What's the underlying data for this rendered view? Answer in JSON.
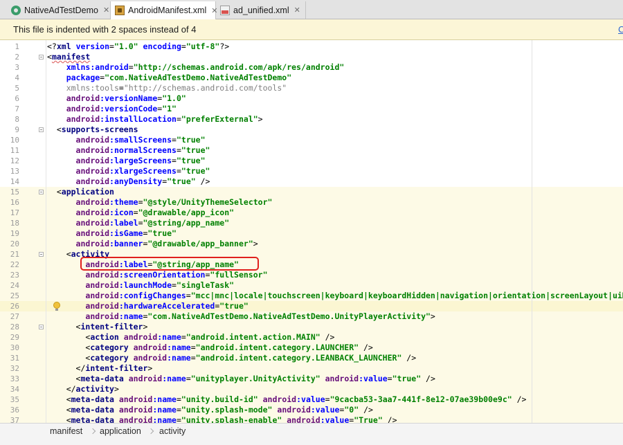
{
  "tabs": [
    {
      "label": "NativeAdTestDemo",
      "icon": "android-icon",
      "active": false
    },
    {
      "label": "AndroidManifest.xml",
      "icon": "manifest-icon",
      "active": true
    },
    {
      "label": "ad_unified.xml",
      "icon": "xml-file-icon",
      "active": false
    }
  ],
  "banner": {
    "message": "This file is indented with 2 spaces instead of 4",
    "link": "C"
  },
  "code_lines": [
    {
      "n": "1",
      "segs": [
        [
          "p",
          "<?"
        ],
        [
          "t",
          "xml "
        ],
        [
          "a",
          "version"
        ],
        [
          "p",
          "="
        ],
        [
          "v",
          "\"1.0\""
        ],
        [
          "p",
          " "
        ],
        [
          "a",
          "encoding"
        ],
        [
          "p",
          "="
        ],
        [
          "v",
          "\"utf-8\""
        ],
        [
          "p",
          "?>"
        ]
      ]
    },
    {
      "n": "2",
      "segs": [
        [
          "p",
          "<"
        ],
        [
          "ts",
          "manifest"
        ]
      ]
    },
    {
      "n": "3",
      "segs": [
        [
          "p",
          "    "
        ],
        [
          "a",
          "xmlns:android"
        ],
        [
          "p",
          "="
        ],
        [
          "v",
          "\"http://schemas.android.com/apk/res/android\""
        ]
      ]
    },
    {
      "n": "4",
      "segs": [
        [
          "p",
          "    "
        ],
        [
          "a",
          "package"
        ],
        [
          "p",
          "="
        ],
        [
          "v",
          "\"com.NativeAdTestDemo.NativeAdTestDemo\""
        ]
      ]
    },
    {
      "n": "5",
      "segs": [
        [
          "p",
          "    "
        ],
        [
          "g",
          "xmlns:tools"
        ],
        [
          "p",
          "="
        ],
        [
          "g",
          "\"http://schemas.android.com/tools\""
        ]
      ]
    },
    {
      "n": "6",
      "segs": [
        [
          "p",
          "    "
        ],
        [
          "n",
          "android"
        ],
        [
          "a",
          ":versionName"
        ],
        [
          "p",
          "="
        ],
        [
          "v",
          "\"1.0\""
        ]
      ]
    },
    {
      "n": "7",
      "segs": [
        [
          "p",
          "    "
        ],
        [
          "n",
          "android"
        ],
        [
          "a",
          ":versionCode"
        ],
        [
          "p",
          "="
        ],
        [
          "v",
          "\"1\""
        ]
      ]
    },
    {
      "n": "8",
      "segs": [
        [
          "p",
          "    "
        ],
        [
          "n",
          "android"
        ],
        [
          "a",
          ":installLocation"
        ],
        [
          "p",
          "="
        ],
        [
          "v",
          "\"preferExternal\""
        ],
        [
          "p",
          ">"
        ]
      ]
    },
    {
      "n": "9",
      "segs": [
        [
          "p",
          "  <"
        ],
        [
          "t",
          "supports-screens"
        ]
      ]
    },
    {
      "n": "10",
      "segs": [
        [
          "p",
          "      "
        ],
        [
          "n",
          "android"
        ],
        [
          "a",
          ":smallScreens"
        ],
        [
          "p",
          "="
        ],
        [
          "v",
          "\"true\""
        ]
      ]
    },
    {
      "n": "11",
      "segs": [
        [
          "p",
          "      "
        ],
        [
          "n",
          "android"
        ],
        [
          "a",
          ":normalScreens"
        ],
        [
          "p",
          "="
        ],
        [
          "v",
          "\"true\""
        ]
      ]
    },
    {
      "n": "12",
      "segs": [
        [
          "p",
          "      "
        ],
        [
          "n",
          "android"
        ],
        [
          "a",
          ":largeScreens"
        ],
        [
          "p",
          "="
        ],
        [
          "v",
          "\"true\""
        ]
      ]
    },
    {
      "n": "13",
      "segs": [
        [
          "p",
          "      "
        ],
        [
          "n",
          "android"
        ],
        [
          "a",
          ":xlargeScreens"
        ],
        [
          "p",
          "="
        ],
        [
          "v",
          "\"true\""
        ]
      ]
    },
    {
      "n": "14",
      "segs": [
        [
          "p",
          "      "
        ],
        [
          "n",
          "android"
        ],
        [
          "a",
          ":anyDensity"
        ],
        [
          "p",
          "="
        ],
        [
          "v",
          "\"true\""
        ],
        [
          "p",
          " />"
        ]
      ]
    },
    {
      "n": "15",
      "segs": [
        [
          "p",
          "  <"
        ],
        [
          "t",
          "application"
        ]
      ]
    },
    {
      "n": "16",
      "segs": [
        [
          "p",
          "      "
        ],
        [
          "n",
          "android"
        ],
        [
          "a",
          ":theme"
        ],
        [
          "p",
          "="
        ],
        [
          "v",
          "\"@style/UnityThemeSelector\""
        ]
      ]
    },
    {
      "n": "17",
      "segs": [
        [
          "p",
          "      "
        ],
        [
          "n",
          "android"
        ],
        [
          "a",
          ":icon"
        ],
        [
          "p",
          "="
        ],
        [
          "v",
          "\"@drawable/app_icon\""
        ]
      ]
    },
    {
      "n": "18",
      "segs": [
        [
          "p",
          "      "
        ],
        [
          "n",
          "android"
        ],
        [
          "a",
          ":label"
        ],
        [
          "p",
          "="
        ],
        [
          "v",
          "\"@string/app_name\""
        ]
      ]
    },
    {
      "n": "19",
      "segs": [
        [
          "p",
          "      "
        ],
        [
          "n",
          "android"
        ],
        [
          "a",
          ":isGame"
        ],
        [
          "p",
          "="
        ],
        [
          "v",
          "\"true\""
        ]
      ]
    },
    {
      "n": "20",
      "segs": [
        [
          "p",
          "      "
        ],
        [
          "n",
          "android"
        ],
        [
          "a",
          ":banner"
        ],
        [
          "p",
          "="
        ],
        [
          "v",
          "\"@drawable/app_banner\""
        ],
        [
          "p",
          ">"
        ]
      ]
    },
    {
      "n": "21",
      "segs": [
        [
          "p",
          "    <"
        ],
        [
          "t",
          "activity"
        ]
      ]
    },
    {
      "n": "22",
      "segs": [
        [
          "p",
          "        "
        ],
        [
          "n",
          "android"
        ],
        [
          "a",
          ":label"
        ],
        [
          "p",
          "="
        ],
        [
          "v",
          "\"@string/app_name\""
        ]
      ]
    },
    {
      "n": "23",
      "segs": [
        [
          "p",
          "        "
        ],
        [
          "n",
          "android"
        ],
        [
          "a",
          ":screenOrientation"
        ],
        [
          "p",
          "="
        ],
        [
          "v",
          "\"fullSensor\""
        ]
      ]
    },
    {
      "n": "24",
      "segs": [
        [
          "p",
          "        "
        ],
        [
          "n",
          "android"
        ],
        [
          "a",
          ":launchMode"
        ],
        [
          "p",
          "="
        ],
        [
          "v",
          "\"singleTask\""
        ]
      ]
    },
    {
      "n": "25",
      "segs": [
        [
          "p",
          "        "
        ],
        [
          "n",
          "android"
        ],
        [
          "a",
          ":configChanges"
        ],
        [
          "p",
          "="
        ],
        [
          "v",
          "\"mcc|mnc|locale|touchscreen|keyboard|keyboardHidden|navigation|orientation|screenLayout|uiMode\""
        ]
      ]
    },
    {
      "n": "26",
      "segs": [
        [
          "p",
          "        "
        ],
        [
          "n",
          "android"
        ],
        [
          "a",
          ":hardwareAccelerated"
        ],
        [
          "p",
          "="
        ],
        [
          "v",
          "\"true\""
        ]
      ]
    },
    {
      "n": "27",
      "segs": [
        [
          "p",
          "        "
        ],
        [
          "n",
          "android"
        ],
        [
          "a",
          ":name"
        ],
        [
          "p",
          "="
        ],
        [
          "v",
          "\"com.NativeAdTestDemo.NativeAdTestDemo.UnityPlayerActivity\""
        ],
        [
          "p",
          ">"
        ]
      ]
    },
    {
      "n": "28",
      "segs": [
        [
          "p",
          "      <"
        ],
        [
          "t",
          "intent-filter"
        ],
        [
          "p",
          ">"
        ]
      ]
    },
    {
      "n": "29",
      "segs": [
        [
          "p",
          "        <"
        ],
        [
          "t",
          "action "
        ],
        [
          "n",
          "android"
        ],
        [
          "a",
          ":name"
        ],
        [
          "p",
          "="
        ],
        [
          "v",
          "\"android.intent.action.MAIN\""
        ],
        [
          "p",
          " />"
        ]
      ]
    },
    {
      "n": "30",
      "segs": [
        [
          "p",
          "        <"
        ],
        [
          "t",
          "category "
        ],
        [
          "n",
          "android"
        ],
        [
          "a",
          ":name"
        ],
        [
          "p",
          "="
        ],
        [
          "v",
          "\"android.intent.category.LAUNCHER\""
        ],
        [
          "p",
          " />"
        ]
      ]
    },
    {
      "n": "31",
      "segs": [
        [
          "p",
          "        <"
        ],
        [
          "t",
          "category "
        ],
        [
          "n",
          "android"
        ],
        [
          "a",
          ":name"
        ],
        [
          "p",
          "="
        ],
        [
          "v",
          "\"android.intent.category.LEANBACK_LAUNCHER\""
        ],
        [
          "p",
          " />"
        ]
      ]
    },
    {
      "n": "32",
      "segs": [
        [
          "p",
          "      </"
        ],
        [
          "t",
          "intent-filter"
        ],
        [
          "p",
          ">"
        ]
      ]
    },
    {
      "n": "33",
      "segs": [
        [
          "p",
          "      <"
        ],
        [
          "t",
          "meta-data "
        ],
        [
          "n",
          "android"
        ],
        [
          "a",
          ":name"
        ],
        [
          "p",
          "="
        ],
        [
          "v",
          "\"unityplayer.UnityActivity\""
        ],
        [
          "p",
          " "
        ],
        [
          "n",
          "android"
        ],
        [
          "a",
          ":value"
        ],
        [
          "p",
          "="
        ],
        [
          "v",
          "\"true\""
        ],
        [
          "p",
          " />"
        ]
      ]
    },
    {
      "n": "34",
      "segs": [
        [
          "p",
          "    </"
        ],
        [
          "t",
          "activity"
        ],
        [
          "p",
          ">"
        ]
      ]
    },
    {
      "n": "35",
      "segs": [
        [
          "p",
          "    <"
        ],
        [
          "t",
          "meta-data "
        ],
        [
          "n",
          "android"
        ],
        [
          "a",
          ":name"
        ],
        [
          "p",
          "="
        ],
        [
          "v",
          "\"unity.build-id\""
        ],
        [
          "p",
          " "
        ],
        [
          "n",
          "android"
        ],
        [
          "a",
          ":value"
        ],
        [
          "p",
          "="
        ],
        [
          "v",
          "\"9cacba53-3aa7-441f-8e12-07ae39b00e9c\""
        ],
        [
          "p",
          " />"
        ]
      ]
    },
    {
      "n": "36",
      "segs": [
        [
          "p",
          "    <"
        ],
        [
          "t",
          "meta-data "
        ],
        [
          "n",
          "android"
        ],
        [
          "a",
          ":name"
        ],
        [
          "p",
          "="
        ],
        [
          "v",
          "\"unity.splash-mode\""
        ],
        [
          "p",
          " "
        ],
        [
          "n",
          "android"
        ],
        [
          "a",
          ":value"
        ],
        [
          "p",
          "="
        ],
        [
          "v",
          "\"0\""
        ],
        [
          "p",
          " />"
        ]
      ]
    },
    {
      "n": "37",
      "segs": [
        [
          "p",
          "    <"
        ],
        [
          "t",
          "meta-data "
        ],
        [
          "n",
          "android"
        ],
        [
          "a",
          ":name"
        ],
        [
          "p",
          "="
        ],
        [
          "v",
          "\"unity.splash-enable\""
        ],
        [
          "p",
          " "
        ],
        [
          "n",
          "android"
        ],
        [
          "a",
          ":value"
        ],
        [
          "p",
          "="
        ],
        [
          "v",
          "\"True\""
        ],
        [
          "p",
          " />"
        ]
      ]
    }
  ],
  "highlight_lines_from": 15,
  "caret_line": 26,
  "breadcrumb": [
    "manifest",
    "application",
    "activity"
  ],
  "colors": {
    "tag": "#000080",
    "namespace": "#660e7a",
    "attribute": "#0000ff",
    "value": "#008000",
    "highlight_box": "#e0201c",
    "banner_bg": "#fcf6d7"
  }
}
